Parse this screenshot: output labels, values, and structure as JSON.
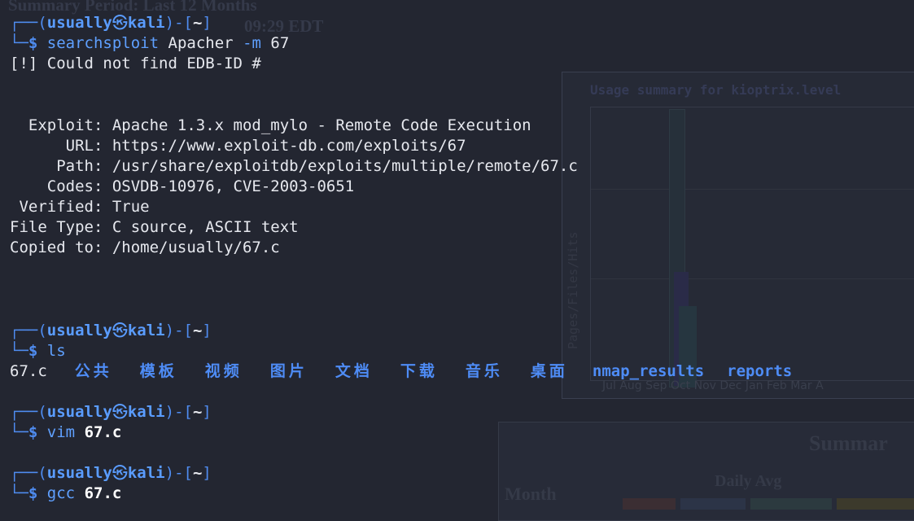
{
  "background_page": {
    "line1": "Summary Period: Last 12 Months",
    "line2": "09:29 EDT",
    "panel_title": "Usage summary for kioptrix.level",
    "ylabel": "Pages/Files/Hits",
    "xlabels": "Jul Aug Sep Oct Nov Dec Jan Feb Mar A",
    "summary": "Summar",
    "month": "Month",
    "daily_avg": "Daily Avg"
  },
  "prompt": {
    "open": "┌──(",
    "user": "usually",
    "at": "㉿",
    "host": "kali",
    "mid": ")-[",
    "path": "~",
    "close": "]",
    "corner": "└─",
    "dollar": "$"
  },
  "commands": [
    {
      "name": "searchsploit",
      "args": "Apacher",
      "option": "-m",
      "value": "67"
    },
    {
      "name": "ls"
    },
    {
      "name": "vim",
      "value": "67.c"
    },
    {
      "name": "gcc",
      "value": "67.c"
    }
  ],
  "output": {
    "error": "[!] Could not find EDB-ID #",
    "exploit": "  Exploit: Apache 1.3.x mod_mylo - Remote Code Execution",
    "url": "      URL: https://www.exploit-db.com/exploits/67",
    "path": "     Path: /usr/share/exploitdb/exploits/multiple/remote/67.c",
    "codes": "    Codes: OSVDB-10976, CVE-2003-0651",
    "verified": " Verified: True",
    "filetype": "File Type: C source, ASCII text",
    "copied": "Copied to: /home/usually/67.c"
  },
  "ls_output": {
    "file": "67.c",
    "dirs": [
      "公共",
      "模板",
      "视频",
      "图片",
      "文档",
      "下载",
      "音乐",
      "桌面",
      "nmap_results",
      "reports"
    ]
  },
  "colors": {
    "background": "#232631",
    "prompt_frame": "#4f8cf0",
    "username": "#5a9cff",
    "command": "#5fa0ff",
    "directory": "#4e8cf6",
    "text": "#e6e8ee"
  }
}
